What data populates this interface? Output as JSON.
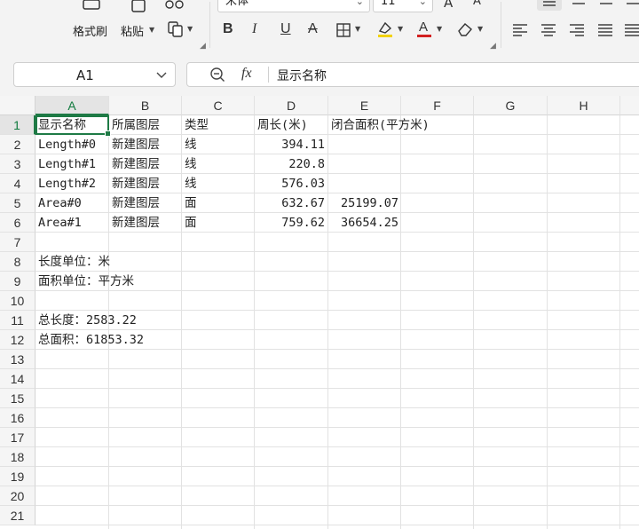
{
  "ribbon": {
    "format_painter_label": "格式刷",
    "paste_label": "粘贴",
    "font_name": "宋体",
    "font_size": "11",
    "bold": "B",
    "italic": "I",
    "underline": "U",
    "strike": "A",
    "grow_font": "A",
    "shrink_font": "A",
    "font_color_letter": "A"
  },
  "formula_bar": {
    "cell_ref": "A1",
    "fx": "fx",
    "content": "显示名称"
  },
  "columns": [
    "A",
    "B",
    "C",
    "D",
    "E",
    "F",
    "G",
    "H"
  ],
  "rows": [
    "1",
    "2",
    "3",
    "4",
    "5",
    "6",
    "7",
    "8",
    "9",
    "10",
    "11",
    "12",
    "13",
    "14",
    "15",
    "16",
    "17",
    "18",
    "19",
    "20",
    "21"
  ],
  "cells": {
    "r1": {
      "a": "显示名称",
      "b": "所属图层",
      "c": "类型",
      "d": "周长(米)",
      "e": "闭合面积(平方米)"
    },
    "r2": {
      "a": "Length#0",
      "b": "新建图层",
      "c": "线",
      "d": "394.11",
      "e": ""
    },
    "r3": {
      "a": "Length#1",
      "b": "新建图层",
      "c": "线",
      "d": "220.8",
      "e": ""
    },
    "r4": {
      "a": "Length#2",
      "b": "新建图层",
      "c": "线",
      "d": "576.03",
      "e": ""
    },
    "r5": {
      "a": "Area#0",
      "b": "新建图层",
      "c": "面",
      "d": "632.67",
      "e": "25199.07"
    },
    "r6": {
      "a": "Area#1",
      "b": "新建图层",
      "c": "面",
      "d": "759.62",
      "e": "36654.25"
    },
    "r8": {
      "a": "长度单位：米"
    },
    "r9": {
      "a": "面积单位：平方米"
    },
    "r11": {
      "a": "总长度：2583.22"
    },
    "r12": {
      "a": "总面积：61853.32"
    }
  },
  "colors": {
    "accent": "#1e7a45",
    "highlight_yellow": "#f2d200",
    "font_red": "#d22020"
  }
}
